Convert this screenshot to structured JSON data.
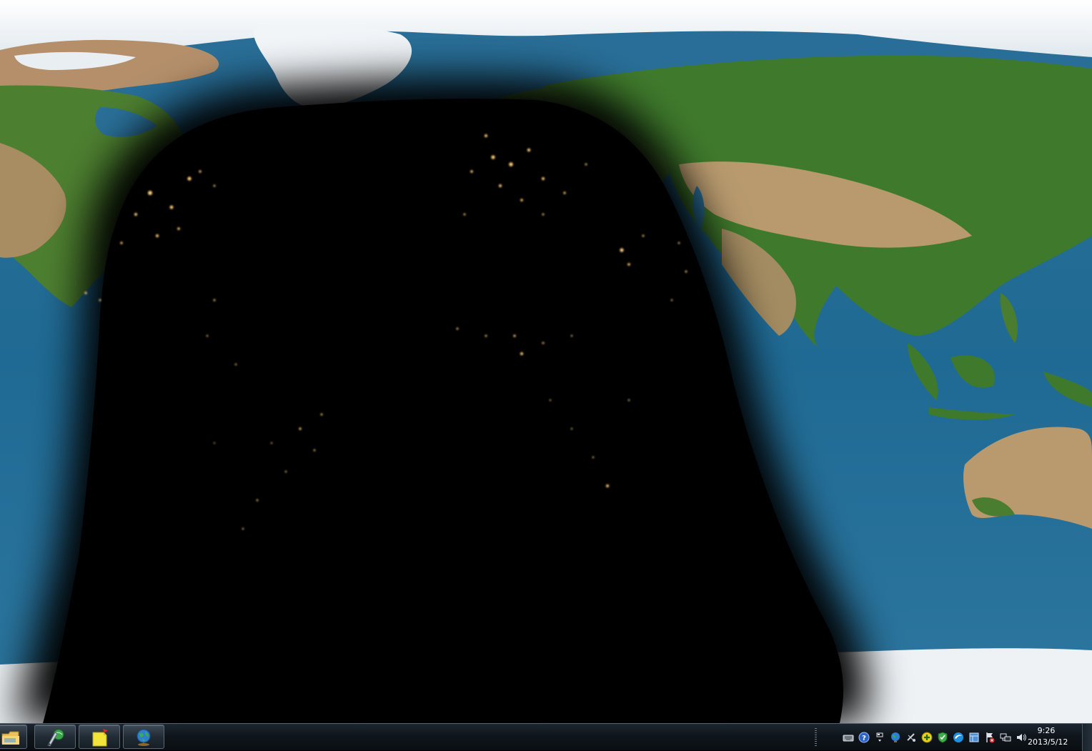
{
  "desktop": {
    "wallpaper": "world-daylight-map",
    "colors": {
      "ocean": "#1f6a94",
      "land_green": "#3f7a2c",
      "land_desert": "#b89a6e",
      "ice": "#eef2f5",
      "night": "#000000",
      "city_lights": "#ffcf7a"
    }
  },
  "taskbar": {
    "pinned": [
      {
        "name": "file-explorer-button",
        "icon": "folder-icon"
      },
      {
        "name": "pen-tablet-button",
        "icon": "pen-globe-icon"
      },
      {
        "name": "notes-button",
        "icon": "sticky-note-icon"
      },
      {
        "name": "globe-app-button",
        "icon": "globe-icon"
      }
    ],
    "tray_icons": [
      "keyboard-icon",
      "help-icon",
      "flag-icon",
      "network-globe-icon",
      "satellite-icon",
      "add-icon",
      "security-shield-icon",
      "browser-icon",
      "window-icon",
      "action-center-icon",
      "network-icon",
      "volume-icon"
    ],
    "clock": {
      "time": "9:26",
      "date": "2013/5/12"
    }
  }
}
